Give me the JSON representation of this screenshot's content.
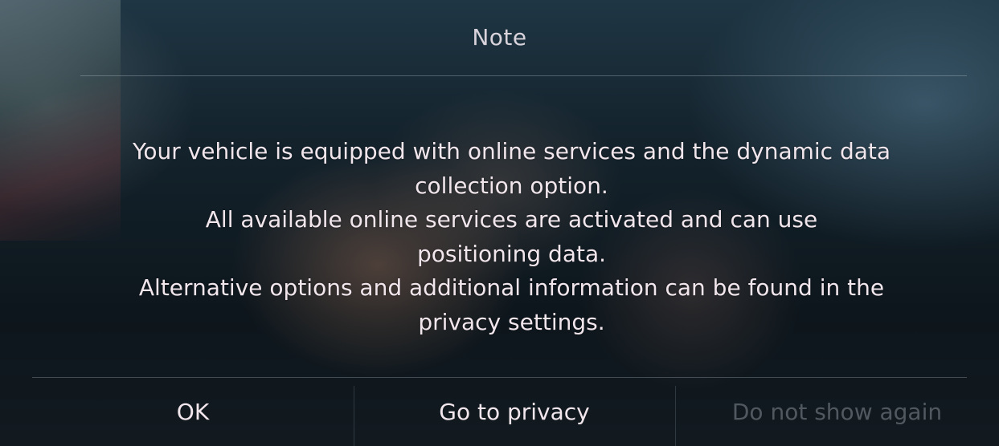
{
  "dialog": {
    "title": "Note",
    "message_lines": [
      "Your vehicle is equipped with online services and the dynamic data",
      "collection option.",
      "All available online services are activated and can use",
      "positioning data.",
      "Alternative options and additional information can be found in the",
      "privacy settings."
    ],
    "buttons": {
      "ok": "OK",
      "go_to_privacy": "Go to privacy",
      "do_not_show_again": "Do not show again"
    }
  },
  "colors": {
    "text": "#f1e6ec",
    "title": "#d9d3dc",
    "background": "#14232d"
  }
}
